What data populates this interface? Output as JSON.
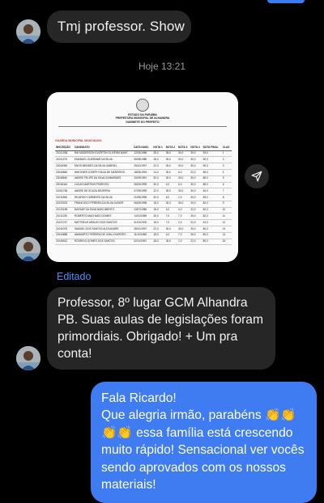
{
  "messages": {
    "first": {
      "text": "Tmj professor. Show"
    },
    "timestamp": "Hoje 13:21",
    "edited_label": "Editado",
    "second": {
      "text": "Professor, 8º lugar GCM Alhandra PB. Suas aulas de legislações foram primordiais. Obrigado! + Um pra conta!"
    },
    "reply": {
      "text": "Fala Ricardo!\nQue alegria irmão,  parabéns 👏👏\n👏👏 essa família está crescendo muito rápido! Sensacional ver vocês sendo aprovados com os nossos materiais!"
    }
  },
  "document": {
    "header": [
      "ESTADO DA PARAÍBA",
      "PREFEITURA MUNICIPAL DE ALHANDRA",
      "GABINETE DO PREFEITO"
    ],
    "subtitle_label": "GUARDA MUNICIPAL MASCULINO",
    "columns": [
      "INSCRIÇÃO",
      "CANDIDATO",
      "DATA NASC.",
      "NOTA 1",
      "NOTA 2",
      "NOTA 3",
      "NOTA 4",
      "NOTA FINAL",
      "CLAS"
    ],
    "rows": [
      [
        "21041268",
        "RAI MADERSON EVERTON OLIVEIRA NAVE",
        "12/04/1988",
        "28,0",
        "35,0",
        "30,0",
        "30,0",
        "93,0",
        "1"
      ],
      [
        "21041270",
        "EMANUEL GUEDMAR DA SILVA",
        "30/08/1986",
        "18,0",
        "30,0",
        "30,0",
        "30,0",
        "90,0",
        "2"
      ],
      [
        "22045390",
        "ENOS MENDES DA SILVA GABRIEL",
        "25/10/1997",
        "22,0",
        "30,0",
        "30,0",
        "30,0",
        "90,0",
        "3"
      ],
      [
        "22045846",
        "WAYGNER JOSEPH SILVA DE MEDEIROS",
        "18/05/1994",
        "14,0",
        "30,0",
        "6,0",
        "22,0",
        "86,0",
        "4"
      ],
      [
        "22048640",
        "ANDRE FELIPE DA SILVA GUIMARAES",
        "10/09/1991",
        "30,0",
        "30,0",
        "30,0",
        "30,0",
        "86,0",
        "5"
      ],
      [
        "22046444",
        "LUCAS MARTINS PEDROSO",
        "26/03/1995",
        "30,0",
        "4,0",
        "6,0",
        "30,0",
        "86,0",
        "6"
      ],
      [
        "21061748",
        "ANDRE DE SOUZA BEZERRA",
        "07/09/1995",
        "22,0",
        "30,0",
        "30,0",
        "30,0",
        "84,0",
        "7"
      ],
      [
        "21011808",
        "RICARDO CARNEIRO DA SILVA",
        "21/06/1996",
        "30,0",
        "6,0",
        "2,0",
        "30,0",
        "83,0",
        "8"
      ],
      [
        "21020023",
        "FRANCISCO PEREIRA DA SILVA JUNIOR",
        "06/05/1998",
        "18,0",
        "30,0",
        "30,0",
        "30,0",
        "82,0",
        "9"
      ],
      [
        "21010185",
        "DAVSAR DA SILVA NASCIMENTO",
        "13/07/1986",
        "18,0",
        "4,0",
        "4,0",
        "22,0",
        "82,0",
        "10"
      ],
      [
        "21011239",
        "ROBERTO MACHADO GOMES",
        "14/11/1988",
        "26,0",
        "7,0",
        "7,0",
        "30,0",
        "82,0",
        "11"
      ],
      [
        "21021747",
        "MATTHEUS ARAUJO DOS SANTOS",
        "31/01/2000",
        "18,0",
        "7,0",
        "2,0",
        "22,0",
        "81,0",
        "12"
      ],
      [
        "21040375",
        "SAMUEL DOS SANTOS ALEXANDRE",
        "28/10/1997",
        "22,0",
        "30,0",
        "30,0",
        "30,0",
        "80,0",
        "13"
      ],
      [
        "22044888",
        "ANAMARTO PEREIRA DE LIMA LOUREIRO",
        "11/10/1988",
        "18,0",
        "4,0",
        "7,0",
        "26,0",
        "80,0",
        "14"
      ],
      [
        "21045612",
        "RODRIGO GOMES DOS SANTOS",
        "02/11/1992",
        "18,0",
        "30,0",
        "2,0",
        "22,0",
        "80,0",
        "15"
      ]
    ]
  },
  "colors": {
    "incoming_bubble": "#262626",
    "outgoing_bubble": "#3f7cf1",
    "edited": "#4d8ef7",
    "background": "#000000"
  },
  "icons": {
    "avatar": "avatar-photo",
    "share": "send-arrow-icon"
  }
}
